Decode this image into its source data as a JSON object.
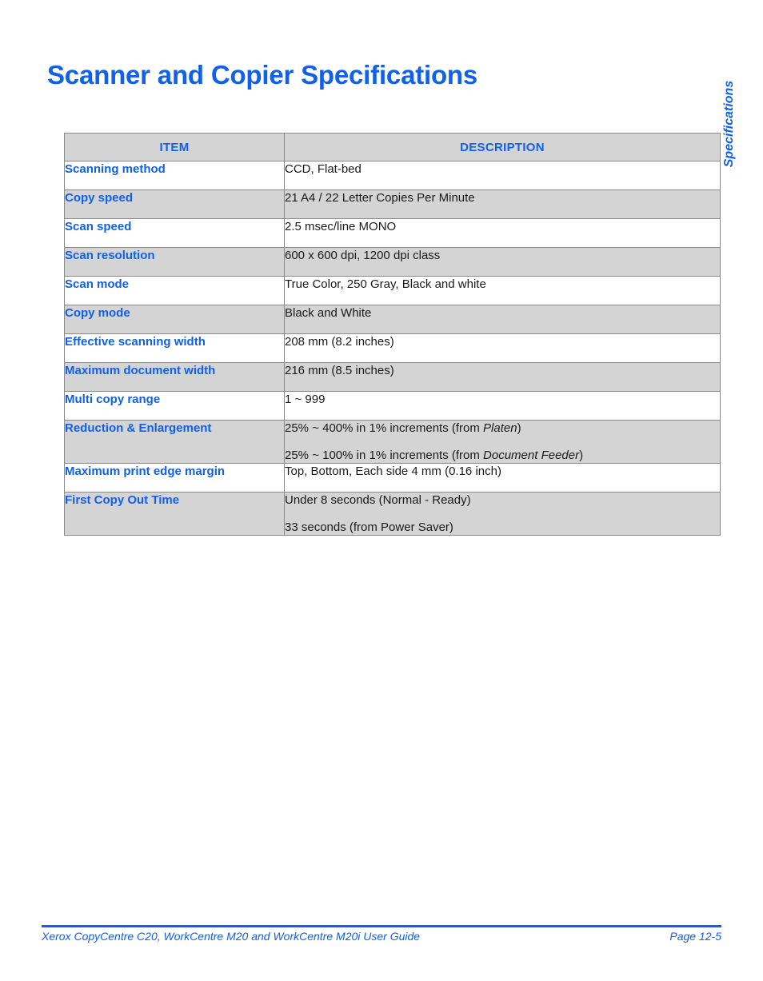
{
  "page": {
    "title": "Scanner and Copier Specifications",
    "side_tab_label": "Specifications"
  },
  "table": {
    "headers": {
      "item": "ITEM",
      "description": "DESCRIPTION"
    },
    "rows": [
      {
        "item": "Scanning method",
        "lines": [
          "CCD, Flat-bed"
        ]
      },
      {
        "item": "Copy speed",
        "lines": [
          "21 A4 / 22 Letter Copies Per Minute"
        ]
      },
      {
        "item": "Scan speed",
        "lines": [
          "2.5 msec/line MONO"
        ]
      },
      {
        "item": "Scan resolution",
        "lines": [
          "600 x 600 dpi, 1200 dpi class"
        ]
      },
      {
        "item": "Scan mode",
        "lines": [
          "True Color, 250 Gray, Black and white"
        ]
      },
      {
        "item": "Copy mode",
        "lines": [
          "Black and White"
        ]
      },
      {
        "item": "Effective scanning width",
        "lines": [
          "208 mm (8.2 inches)"
        ]
      },
      {
        "item": "Maximum document width",
        "lines": [
          "216 mm (8.5 inches)"
        ]
      },
      {
        "item": "Multi copy range",
        "lines": [
          "1 ~ 999"
        ]
      },
      {
        "item": "Reduction & Enlargement",
        "lines": [
          "25% ~ 400% in 1% increments (from Platen)",
          "25% ~ 100% in 1% increments (from Document Feeder)"
        ],
        "italic_spans": [
          "Platen",
          "Document Feeder"
        ]
      },
      {
        "item": "Maximum print edge margin",
        "lines": [
          "Top, Bottom, Each side 4 mm (0.16 inch)"
        ]
      },
      {
        "item": "First Copy Out Time",
        "lines": [
          "Under 8 seconds (Normal - Ready)",
          "33 seconds (from Power Saver)"
        ]
      }
    ]
  },
  "footer": {
    "guide": "Xerox CopyCentre C20, WorkCentre M20 and WorkCentre M20i User Guide",
    "page_number": "Page 12-5"
  },
  "colors": {
    "accent_blue": "#1060E8",
    "header_grey": "#d4d4d4",
    "border_grey": "#8a8a8a",
    "body_text": "#1a1a1a"
  }
}
